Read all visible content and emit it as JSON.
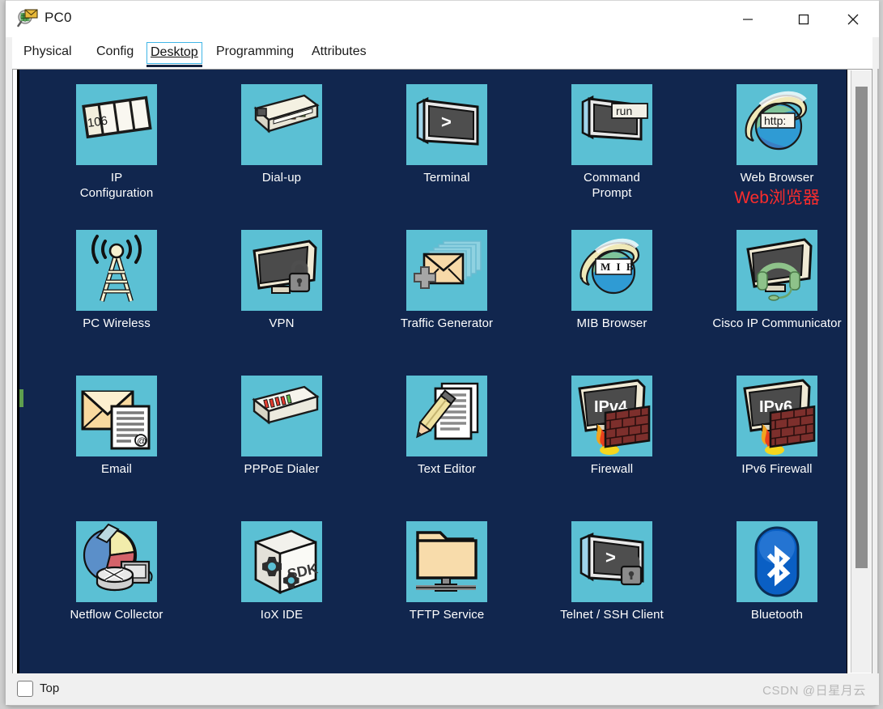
{
  "window": {
    "title": "PC0",
    "icon": "packet-tracer-inspect-icon",
    "controls": {
      "minimize": "–",
      "maximize": "▢",
      "close": "✕"
    }
  },
  "tabs": [
    {
      "label": "Physical",
      "active": false
    },
    {
      "label": "Config",
      "active": false
    },
    {
      "label": "Desktop",
      "active": true
    },
    {
      "label": "Programming",
      "active": false
    },
    {
      "label": "Attributes",
      "active": false
    }
  ],
  "desktop": {
    "background_color": "#11264e",
    "tile_color": "#5bc0d4",
    "items": [
      {
        "label": "IP\nConfiguration",
        "icon": "ip-configuration-icon",
        "annotation": ""
      },
      {
        "label": "Dial-up",
        "icon": "dial-up-icon",
        "annotation": ""
      },
      {
        "label": "Terminal",
        "icon": "terminal-icon",
        "annotation": ""
      },
      {
        "label": "Command\nPrompt",
        "icon": "command-prompt-icon",
        "annotation": ""
      },
      {
        "label": "Web Browser",
        "icon": "web-browser-icon",
        "annotation": "Web浏览器"
      },
      {
        "label": "PC Wireless",
        "icon": "pc-wireless-icon",
        "annotation": ""
      },
      {
        "label": "VPN",
        "icon": "vpn-icon",
        "annotation": ""
      },
      {
        "label": "Traffic Generator",
        "icon": "traffic-generator-icon",
        "annotation": ""
      },
      {
        "label": "MIB Browser",
        "icon": "mib-browser-icon",
        "annotation": ""
      },
      {
        "label": "Cisco IP Communicator",
        "icon": "cisco-ip-communicator-icon",
        "annotation": ""
      },
      {
        "label": "Email",
        "icon": "email-icon",
        "annotation": ""
      },
      {
        "label": "PPPoE Dialer",
        "icon": "pppoe-dialer-icon",
        "annotation": ""
      },
      {
        "label": "Text Editor",
        "icon": "text-editor-icon",
        "annotation": ""
      },
      {
        "label": "Firewall",
        "icon": "firewall-ipv4-icon",
        "annotation": ""
      },
      {
        "label": "IPv6 Firewall",
        "icon": "firewall-ipv6-icon",
        "annotation": ""
      },
      {
        "label": "Netflow Collector",
        "icon": "netflow-collector-icon",
        "annotation": ""
      },
      {
        "label": "IoX IDE",
        "icon": "iox-ide-icon",
        "annotation": ""
      },
      {
        "label": "TFTP Service",
        "icon": "tftp-service-icon",
        "annotation": ""
      },
      {
        "label": "Telnet / SSH Client",
        "icon": "telnet-ssh-client-icon",
        "annotation": ""
      },
      {
        "label": "Bluetooth",
        "icon": "bluetooth-icon",
        "annotation": ""
      }
    ],
    "icon_text": {
      "ip_config_number": "106",
      "terminal_prompt": ">",
      "command_prompt_run": "run",
      "web_browser_http": "http:",
      "mib_label": "M I B",
      "firewall_v4": "IPv4",
      "firewall_v6": "IPv6",
      "iox_sdk": "SDK",
      "telnet_prompt": ">"
    }
  },
  "bottom": {
    "top_checkbox_label": "Top",
    "top_checkbox_checked": false,
    "watermark": "CSDN @日星月云"
  },
  "colors": {
    "desktop_bg": "#11264e",
    "tile_bg": "#5bc0d4",
    "accent_focus": "#41b6e6",
    "annotation_red": "#fb2c2c",
    "titlebar_bg": "#ffffff",
    "chrome_bg": "#f0f0f0"
  }
}
